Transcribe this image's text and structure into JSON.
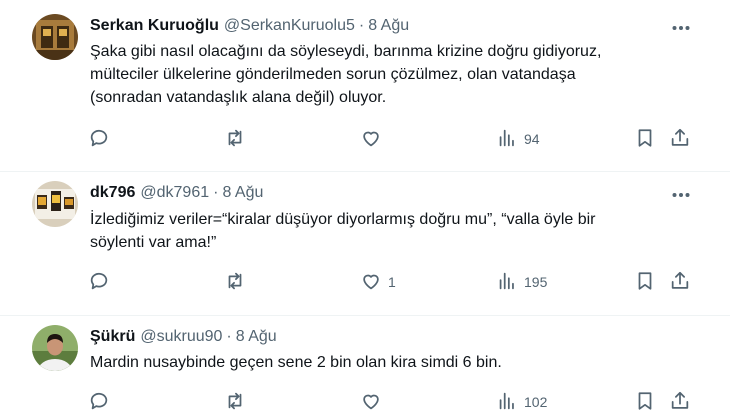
{
  "tweets": [
    {
      "name": "Serkan Kuruoğlu",
      "handle": "@SerkanKuruolu5",
      "separator": "·",
      "time": "8 Ağu",
      "lines": [
        "Şaka gibi nasıl olacağını da söyleseydi, barınma krizine doğru gidiyoruz,",
        "mülteciler ülkelerine gönderilmeden sorun çözülmez, olan vatandaşa",
        "(sonradan vatandaşlık alana değil) oluyor."
      ],
      "like_count": "",
      "views": "94",
      "icons": [
        "reply-icon",
        "retweet-icon",
        "like-icon",
        "views-icon",
        "bookmark-icon",
        "share-icon",
        "more-icon"
      ]
    },
    {
      "name": "dk796",
      "handle": "@dk7961",
      "separator": "·",
      "time": "8 Ağu",
      "lines": [
        "İzlediğimiz veriler=“kiralar düşüyor diyorlarmış doğru mu”, “valla öyle bir",
        "söylenti var ama!”"
      ],
      "like_count": "1",
      "views": "195",
      "icons": [
        "reply-icon",
        "retweet-icon",
        "like-icon",
        "views-icon",
        "bookmark-icon",
        "share-icon",
        "more-icon"
      ]
    },
    {
      "name": "Şükrü",
      "handle": "@sukruu90",
      "separator": "·",
      "time": "8 Ağu",
      "lines": [
        "Mardin nusaybinde geçen sene 2 bin olan kira simdi 6 bin."
      ],
      "like_count": "",
      "views": "102",
      "icons": [
        "reply-icon",
        "retweet-icon",
        "like-icon",
        "views-icon",
        "bookmark-icon",
        "share-icon",
        "more-icon"
      ]
    }
  ],
  "colors": {
    "text": "#0f1419",
    "secondary": "#536471",
    "divider": "#eff3f4",
    "background": "#ffffff"
  }
}
